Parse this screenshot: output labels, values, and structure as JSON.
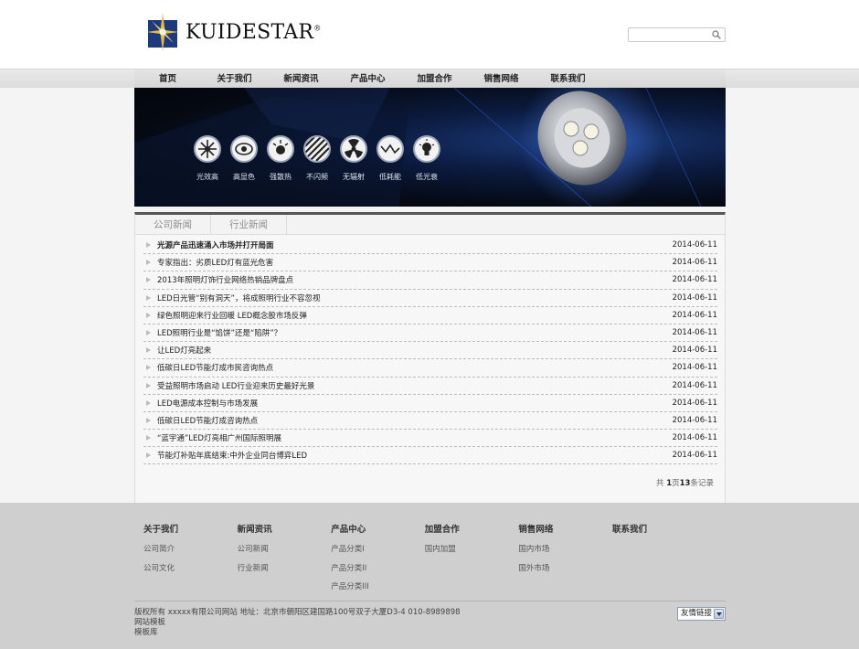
{
  "brand": {
    "name": "KUIDESTAR",
    "reg": "®"
  },
  "search": {
    "placeholder": ""
  },
  "nav": [
    "首页",
    "关于我们",
    "新闻资讯",
    "产品中心",
    "加盟合作",
    "销售网络",
    "联系我们"
  ],
  "banner": {
    "features": [
      "光效高",
      "高显色",
      "强散热",
      "不闪频",
      "无辐射",
      "低耗能",
      "低光衰"
    ]
  },
  "tabs": [
    "公司新闻",
    "行业新闻"
  ],
  "news": [
    {
      "title": "光源产品迅速涌入市场并打开局面",
      "date": "2014-06-11"
    },
    {
      "title": "专家指出：劣质LED灯有蓝光危害",
      "date": "2014-06-11"
    },
    {
      "title": "2013年照明灯饰行业网络热销品牌盘点",
      "date": "2014-06-11"
    },
    {
      "title": "LED日光管“别有洞天”，将成照明行业不容忽视",
      "date": "2014-06-11"
    },
    {
      "title": "绿色照明迎来行业回暖 LED概念股市场反弹",
      "date": "2014-06-11"
    },
    {
      "title": "LED照明行业是“馅饼”还是“陷阱”？",
      "date": "2014-06-11"
    },
    {
      "title": "让LED灯亮起来",
      "date": "2014-06-11"
    },
    {
      "title": "低碳日LED节能灯成市民咨询热点",
      "date": "2014-06-11"
    },
    {
      "title": "受益照明市场启动 LED行业迎来历史最好光景",
      "date": "2014-06-11"
    },
    {
      "title": "LED电源成本控制与市场发展",
      "date": "2014-06-11"
    },
    {
      "title": "低碳日LED节能灯成咨询热点",
      "date": "2014-06-11"
    },
    {
      "title": "“蓝宇通”LED灯亮相广州国际照明展",
      "date": "2014-06-11"
    },
    {
      "title": "节能灯补贴年底结束:中外企业同台博弈LED",
      "date": "2014-06-11"
    }
  ],
  "pager": {
    "pre": "共 ",
    "page": "1",
    "mid": "页",
    "count": "13",
    "post": "条记录"
  },
  "footer": {
    "columns": [
      {
        "title": "关于我们",
        "links": [
          "公司简介",
          "公司文化"
        ]
      },
      {
        "title": "新闻资讯",
        "links": [
          "公司新闻",
          "行业新闻"
        ]
      },
      {
        "title": "产品中心",
        "links": [
          "产品分类I",
          "产品分类II",
          "产品分类III"
        ]
      },
      {
        "title": "加盟合作",
        "links": [
          "国内加盟"
        ]
      },
      {
        "title": "销售网络",
        "links": [
          "国内市场",
          "国外市场"
        ]
      },
      {
        "title": "联系我们",
        "links": []
      }
    ],
    "copyright": "版权所有 xxxxx有限公司网站 地址：北京市朝阳区建国路100号双子大厦D3-4 010-8989898",
    "line2": "网站模板",
    "line3": "模板库",
    "select_value": "友情链接"
  },
  "colors": {
    "banner_bg": "#050912",
    "footer_bg": "#cfcfcf",
    "panel_border": "#555555"
  }
}
